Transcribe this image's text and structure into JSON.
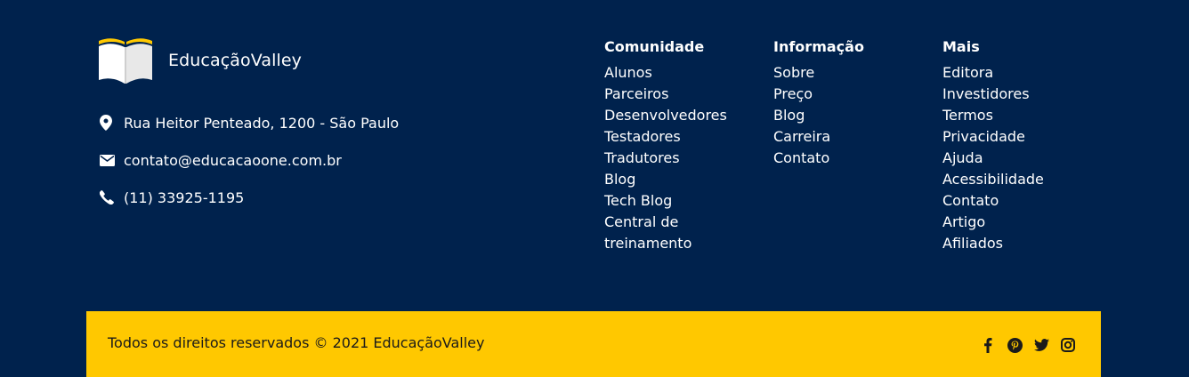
{
  "brand": {
    "name": "EducaçãoValley"
  },
  "contact": {
    "address": "Rua Heitor Penteado, 1200 - São Paulo",
    "email": "contato@educacaoone.com.br",
    "phone": "(11) 33925-1195"
  },
  "columns": [
    {
      "title": "Comunidade",
      "items": [
        "Alunos",
        "Parceiros",
        "Desenvolvedores",
        "Testadores",
        "Tradutores",
        "Blog",
        "Tech Blog",
        "Central de",
        "treinamento"
      ]
    },
    {
      "title": "Informação",
      "items": [
        "Sobre",
        "Preço",
        "Blog",
        "Carreira",
        "Contato"
      ]
    },
    {
      "title": "Mais",
      "items": [
        "Editora",
        "Investidores",
        "Termos",
        "Privacidade",
        "Ajuda",
        "Acessibilidade",
        "Contato",
        "Artigo",
        "Afiliados"
      ]
    }
  ],
  "bottom": {
    "copyright": "Todos os direitos reservados © 2021 EducaçãoValley",
    "social": [
      "facebook-icon",
      "pinterest-icon",
      "twitter-icon",
      "instagram-icon"
    ]
  },
  "colors": {
    "background": "#00224D",
    "bottom_bar": "#FFC800",
    "text_light": "#FFFFFF",
    "text_dark": "#1A1A1A"
  }
}
